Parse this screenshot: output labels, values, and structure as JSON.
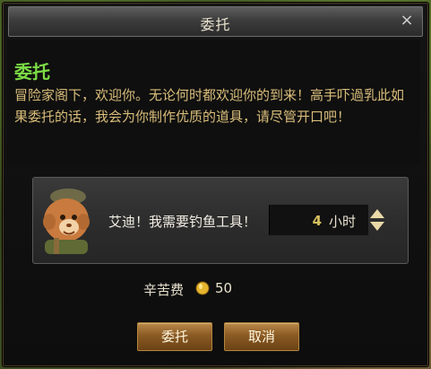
{
  "window": {
    "title": "委托",
    "close_label": "×"
  },
  "intro": {
    "heading": "委托",
    "body": "冒险家阁下，欢迎你。无论何时都欢迎你的到来！高手吓過乳此如果委托的话，我会为你制作优质的道具，请尽管开口吧！"
  },
  "task": {
    "npc_icon": "npc-portrait-icon",
    "request_text": "艾迪！我需要钓鱼工具！",
    "time_value": "4",
    "time_unit": "小时"
  },
  "fee": {
    "label": "辛苦费",
    "coin_icon": "gold-coin-icon",
    "amount": "50"
  },
  "buttons": {
    "commission": "委托",
    "cancel": "取消"
  },
  "colors": {
    "heading": "#7cdc45",
    "body_text": "#d9bd7a",
    "time_value": "#d6c060",
    "button": "#8a5a24"
  }
}
